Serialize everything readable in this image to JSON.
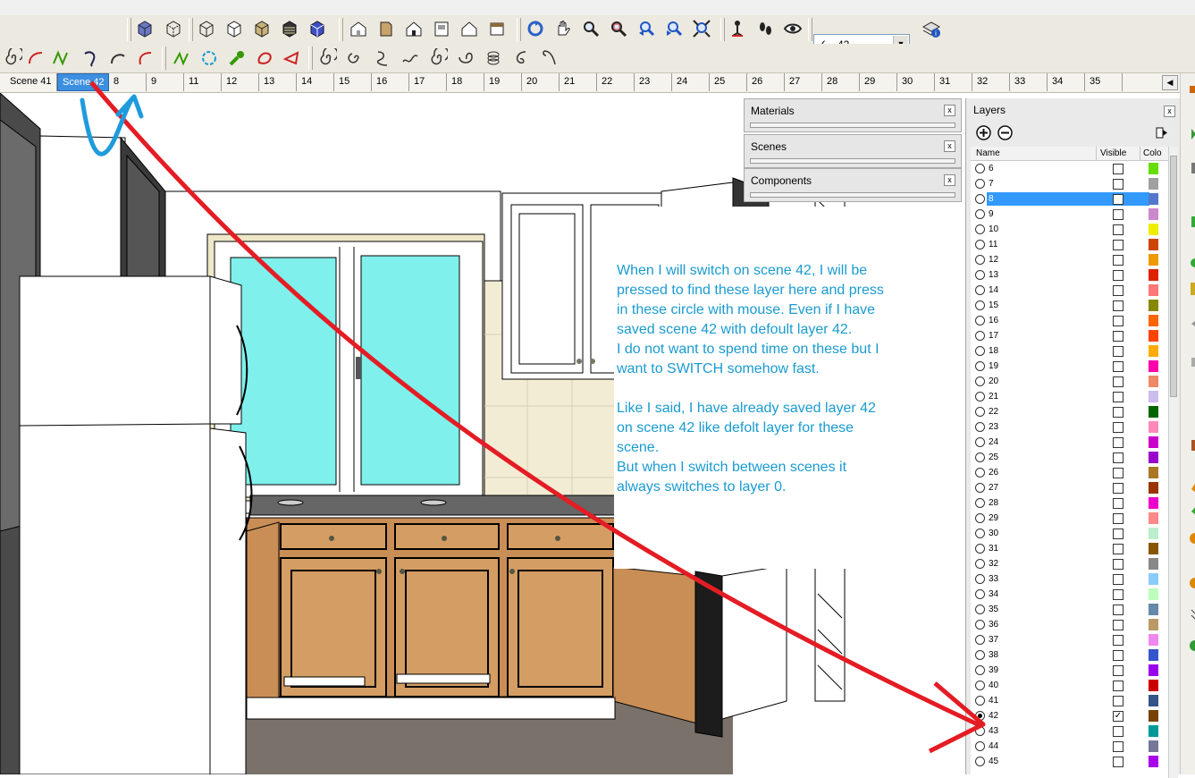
{
  "toolbar": {
    "layer_select_check": "✓",
    "layer_select_value": "42"
  },
  "scenes": {
    "tabs": [
      "Scene 41",
      "Scene 42",
      "8",
      "9",
      "11",
      "12",
      "13",
      "14",
      "15",
      "16",
      "17",
      "18",
      "19",
      "20",
      "21",
      "22",
      "23",
      "24",
      "25",
      "26",
      "27",
      "28",
      "29",
      "30",
      "31",
      "32",
      "33",
      "34",
      "35"
    ],
    "active_index": 1
  },
  "panels": {
    "materials": "Materials",
    "scenes": "Scenes",
    "components": "Components",
    "close_glyph": "x"
  },
  "annotation": {
    "lines": [
      "When I will switch on scene 42, I will be",
      "pressed to find these layer here and press",
      "in these circle with mouse. Even if I have",
      "saved scene 42 with defoult layer 42.",
      "I do not want to spend time on these but I",
      "want to SWITCH somehow fast.",
      "",
      "Like I said, I have already saved layer 42",
      "on scene 42 like defolt layer for these",
      "scene.",
      "But when I switch between scenes it",
      "always switches to layer 0."
    ],
    "color": "#1a9bd0",
    "arrow_color": "#e41c24",
    "scribble_color": "#1e9bdc"
  },
  "layers": {
    "title": "Layers",
    "close_glyph": "x",
    "col_name": "Name",
    "col_visible": "Visible",
    "col_color": "Colo",
    "rows": [
      {
        "name": "6",
        "color": "#66dd00",
        "visible": false,
        "current": false,
        "selected": false
      },
      {
        "name": "7",
        "color": "#a0a0a0",
        "visible": false,
        "current": false,
        "selected": false
      },
      {
        "name": "8",
        "color": "#5577cc",
        "visible": false,
        "current": false,
        "selected": true
      },
      {
        "name": "9",
        "color": "#cc88cc",
        "visible": false,
        "current": false,
        "selected": false
      },
      {
        "name": "10",
        "color": "#eeee00",
        "visible": false,
        "current": false,
        "selected": false
      },
      {
        "name": "11",
        "color": "#cc4400",
        "visible": false,
        "current": false,
        "selected": false
      },
      {
        "name": "12",
        "color": "#ee9900",
        "visible": false,
        "current": false,
        "selected": false
      },
      {
        "name": "13",
        "color": "#dd2200",
        "visible": false,
        "current": false,
        "selected": false
      },
      {
        "name": "14",
        "color": "#ff7777",
        "visible": false,
        "current": false,
        "selected": false
      },
      {
        "name": "15",
        "color": "#888800",
        "visible": false,
        "current": false,
        "selected": false
      },
      {
        "name": "16",
        "color": "#ff6600",
        "visible": false,
        "current": false,
        "selected": false
      },
      {
        "name": "17",
        "color": "#ff4400",
        "visible": false,
        "current": false,
        "selected": false
      },
      {
        "name": "18",
        "color": "#ffaa00",
        "visible": false,
        "current": false,
        "selected": false
      },
      {
        "name": "19",
        "color": "#ff00aa",
        "visible": false,
        "current": false,
        "selected": false
      },
      {
        "name": "20",
        "color": "#ee8866",
        "visible": false,
        "current": false,
        "selected": false
      },
      {
        "name": "21",
        "color": "#ccbbee",
        "visible": false,
        "current": false,
        "selected": false
      },
      {
        "name": "22",
        "color": "#006600",
        "visible": false,
        "current": false,
        "selected": false
      },
      {
        "name": "23",
        "color": "#ff88bb",
        "visible": false,
        "current": false,
        "selected": false
      },
      {
        "name": "24",
        "color": "#cc00cc",
        "visible": false,
        "current": false,
        "selected": false
      },
      {
        "name": "25",
        "color": "#9900cc",
        "visible": false,
        "current": false,
        "selected": false
      },
      {
        "name": "26",
        "color": "#aa7722",
        "visible": false,
        "current": false,
        "selected": false
      },
      {
        "name": "27",
        "color": "#993300",
        "visible": false,
        "current": false,
        "selected": false
      },
      {
        "name": "28",
        "color": "#ee00cc",
        "visible": false,
        "current": false,
        "selected": false
      },
      {
        "name": "29",
        "color": "#ff8888",
        "visible": false,
        "current": false,
        "selected": false
      },
      {
        "name": "30",
        "color": "#bbeecc",
        "visible": false,
        "current": false,
        "selected": false
      },
      {
        "name": "31",
        "color": "#885500",
        "visible": false,
        "current": false,
        "selected": false
      },
      {
        "name": "32",
        "color": "#888888",
        "visible": false,
        "current": false,
        "selected": false
      },
      {
        "name": "33",
        "color": "#88ccff",
        "visible": false,
        "current": false,
        "selected": false
      },
      {
        "name": "34",
        "color": "#bbffbb",
        "visible": false,
        "current": false,
        "selected": false
      },
      {
        "name": "35",
        "color": "#6688aa",
        "visible": false,
        "current": false,
        "selected": false
      },
      {
        "name": "36",
        "color": "#bb9966",
        "visible": false,
        "current": false,
        "selected": false
      },
      {
        "name": "37",
        "color": "#ee88ee",
        "visible": false,
        "current": false,
        "selected": false
      },
      {
        "name": "38",
        "color": "#3355cc",
        "visible": false,
        "current": false,
        "selected": false
      },
      {
        "name": "39",
        "color": "#9900ee",
        "visible": false,
        "current": false,
        "selected": false
      },
      {
        "name": "40",
        "color": "#cc0000",
        "visible": false,
        "current": false,
        "selected": false
      },
      {
        "name": "41",
        "color": "#335588",
        "visible": false,
        "current": false,
        "selected": false
      },
      {
        "name": "42",
        "color": "#774400",
        "visible": true,
        "current": true,
        "selected": false
      },
      {
        "name": "43",
        "color": "#009999",
        "visible": false,
        "current": false,
        "selected": false
      },
      {
        "name": "44",
        "color": "#777799",
        "visible": false,
        "current": false,
        "selected": false
      },
      {
        "name": "45",
        "color": "#aa00ee",
        "visible": false,
        "current": false,
        "selected": false
      }
    ]
  }
}
